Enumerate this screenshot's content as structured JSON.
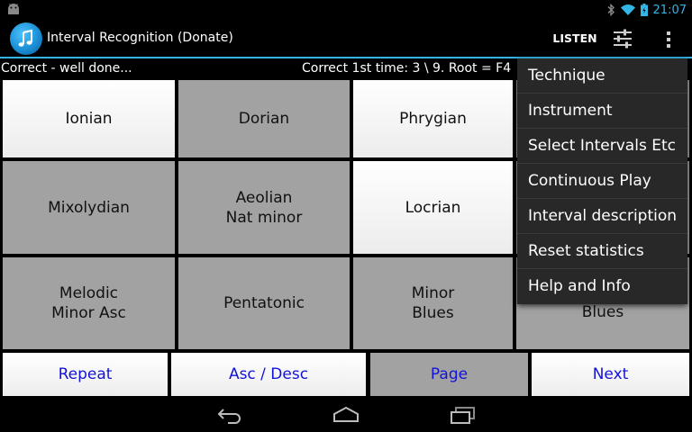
{
  "status_bar": {
    "time": "21:07",
    "icons": [
      "android-icon",
      "bluetooth-icon",
      "wifi-icon",
      "battery-icon"
    ]
  },
  "action_bar": {
    "title": "Interval Recognition (Donate)",
    "listen_label": "LISTEN",
    "icons": [
      "app-icon",
      "sliders-icon",
      "overflow-icon"
    ]
  },
  "info": {
    "left": "Correct - well done...",
    "right": "Correct 1st time: 3 \\ 9.  Root = F4"
  },
  "grid": {
    "cells": [
      {
        "label": "Ionian",
        "style": "white"
      },
      {
        "label": "Dorian",
        "style": "gray"
      },
      {
        "label": "Phrygian",
        "style": "white"
      },
      {
        "label": "Mixolydian",
        "style": "gray"
      },
      {
        "label": "Aeolian\nNat minor",
        "style": "gray"
      },
      {
        "label": "Locrian",
        "style": "white"
      },
      {
        "label": "Melodic\nMinor Asc",
        "style": "gray"
      },
      {
        "label": "Pentatonic",
        "style": "gray"
      },
      {
        "label": "Minor\nBlues",
        "style": "gray"
      },
      {
        "label": "Blues",
        "style": "gray"
      }
    ]
  },
  "bottom_buttons": {
    "repeat": "Repeat",
    "asc_desc": "Asc / Desc",
    "page": "Page",
    "next": "Next"
  },
  "menu": {
    "items": [
      "Technique",
      "Instrument",
      "Select Intervals Etc",
      "Continuous Play",
      "Interval description",
      "Reset statistics",
      "Help and Info"
    ]
  },
  "nav_bar": {
    "icons": [
      "back-icon",
      "home-icon",
      "recent-apps-icon"
    ]
  },
  "colors": {
    "accent": "#33b5e5",
    "button_text": "#1313d6",
    "gray_cell": "#a2a2a2",
    "menu_bg": "#282828"
  }
}
